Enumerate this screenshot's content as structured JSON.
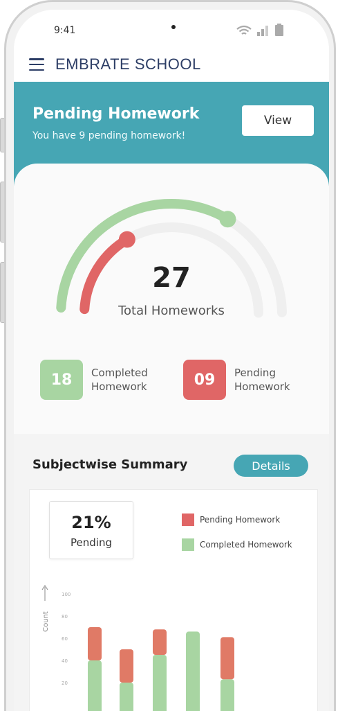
{
  "status_bar": {
    "time": "9:41"
  },
  "app": {
    "title": "EMBRATE SCHOOL"
  },
  "banner": {
    "title": "Pending Homework",
    "subtitle": "You have 9 pending homework!",
    "view_label": "View"
  },
  "progress": {
    "total": "27",
    "total_label": "Total Homeworks",
    "completed_fraction": 0.67,
    "completed_count": "18",
    "completed_label": "Completed Homework",
    "pending_count": "09",
    "pending_label": "Pending Homework"
  },
  "summary": {
    "title": "Subjectwise  Summary",
    "details_label": "Details",
    "pending_percent": "21%",
    "pending_label": "Pending"
  },
  "colors": {
    "accent": "#46a6b4",
    "completed": "#a8d5a2",
    "pending": "#e06666",
    "title": "#2d3e66"
  },
  "chart_data": {
    "type": "bar",
    "stacked": true,
    "ylabel": "Count",
    "yticks": [
      20,
      40,
      60,
      80,
      100
    ],
    "ylim": [
      0,
      100
    ],
    "series": [
      {
        "name": "Completed Homework",
        "color": "#a8d5a2",
        "values": [
          40,
          20,
          45,
          66,
          23
        ]
      },
      {
        "name": "Pending Homework",
        "color": "#e07a66",
        "values": [
          30,
          30,
          23,
          0,
          38
        ]
      }
    ],
    "legend_position": "top-right"
  }
}
